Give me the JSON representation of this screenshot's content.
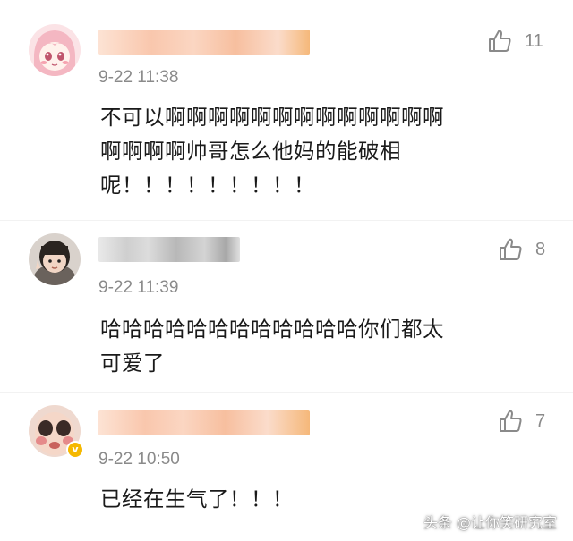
{
  "comments": [
    {
      "avatar_icon": "anime-girl-avatar-icon",
      "time": "9-22 11:38",
      "like_count": "11",
      "lines": [
        "不可以啊啊啊啊啊啊啊啊啊啊啊啊啊",
        "啊啊啊啊帅哥怎么他妈的能破相",
        "呢！！！！！！！！！"
      ]
    },
    {
      "avatar_icon": "child-photo-avatar-icon",
      "time": "9-22 11:39",
      "like_count": "8",
      "lines": [
        "哈哈哈哈哈哈哈哈哈哈哈哈你们都太",
        "可爱了"
      ]
    },
    {
      "avatar_icon": "face-photo-avatar-icon",
      "verified_icon": "verified-badge-icon",
      "time": "9-22 10:50",
      "like_count": "7",
      "lines": [
        "已经在生气了！！！"
      ]
    }
  ],
  "like_icon": "thumbs-up-icon",
  "watermark": "头条 @让你笑研究室",
  "colors": {
    "background": "#f2f2f2",
    "card": "#ffffff",
    "meta_text": "#8a8a8a",
    "body_text": "#1a1a1a",
    "blur_orange": "#f5a878",
    "blur_gray": "#b0b0b0"
  }
}
